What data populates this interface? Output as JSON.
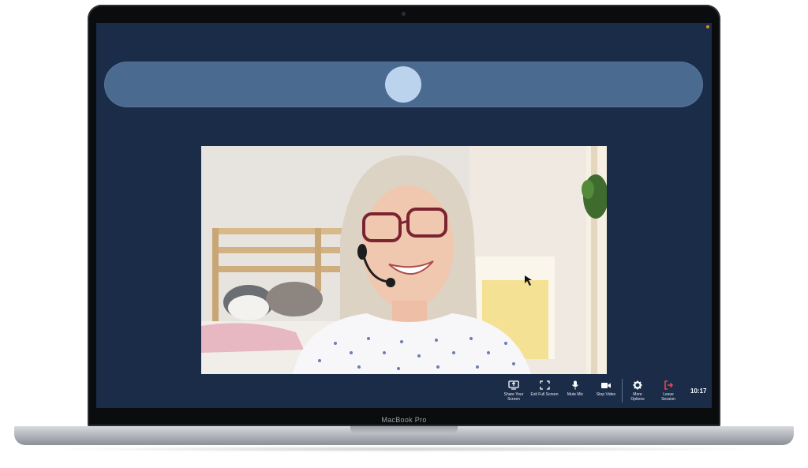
{
  "device": {
    "model_label": "MacBook Pro"
  },
  "session": {
    "participant_avatar": "participant-avatar",
    "status_color": "#e08a1e"
  },
  "toolbar": {
    "share_screen": "Share Your\nScreen",
    "exit_fullscreen": "Exit Full Screen",
    "mute_mic": "Mute Mic",
    "stop_video": "Stop Video",
    "more_options": "More\nOptions",
    "leave_session": "Leave\nSession",
    "clock": "10:17",
    "leave_color": "#e8474c"
  },
  "colors": {
    "screen_bg": "#1a2c48",
    "strip_bg": "#4a6a90",
    "avatar_bg": "#bcd3ee"
  }
}
